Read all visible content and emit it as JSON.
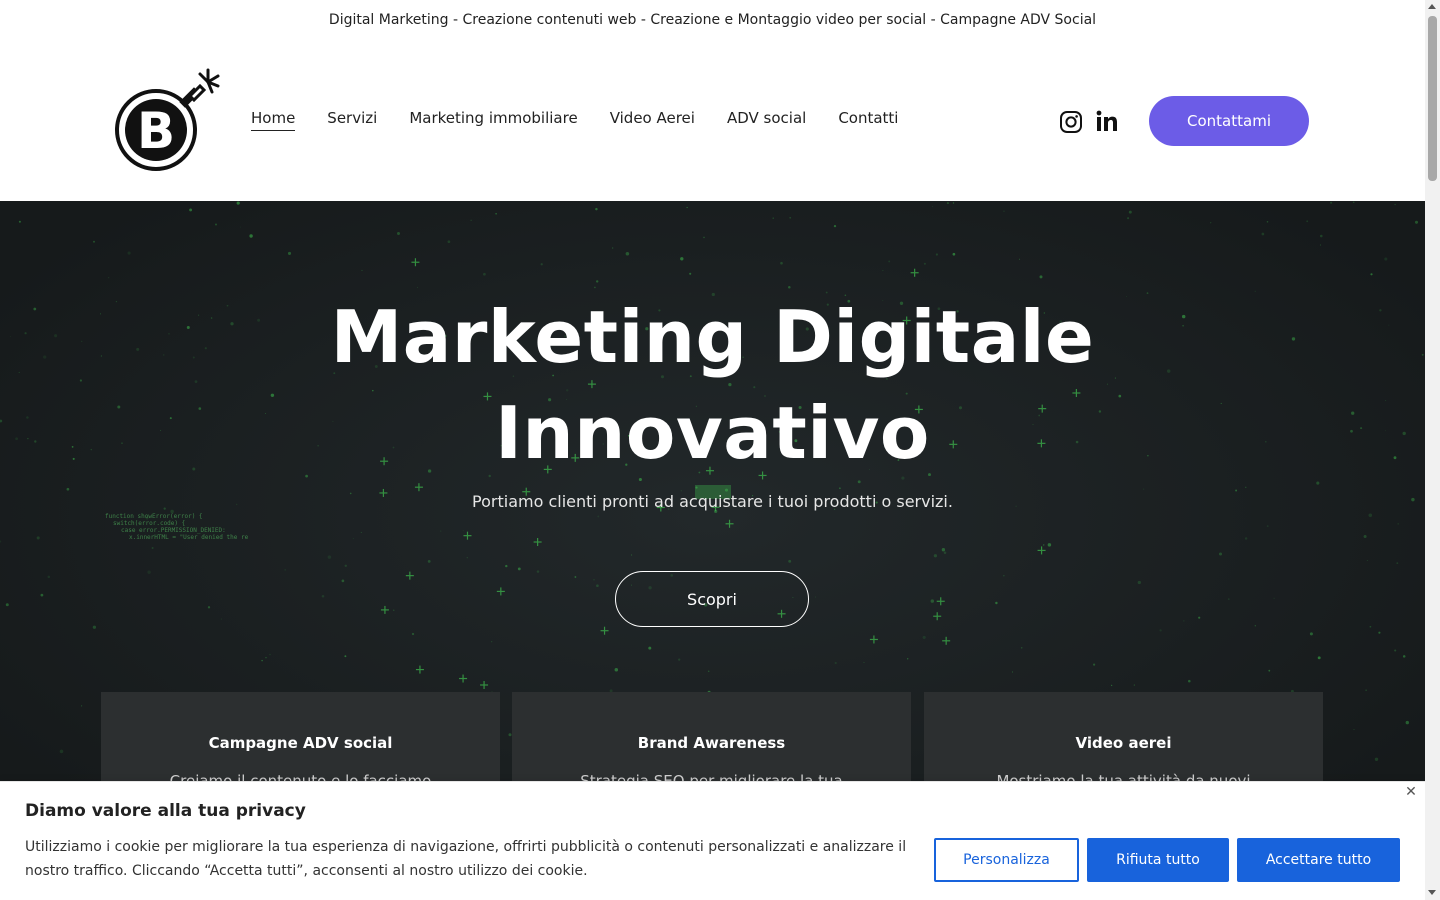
{
  "topbar": {
    "text": "Digital Marketing - Creazione contenuti web - Creazione e Montaggio video per social - Campagne ADV Social"
  },
  "header": {
    "logo_icon": "bomb-logo-icon",
    "nav": [
      {
        "label": "Home",
        "active": true
      },
      {
        "label": "Servizi",
        "active": false
      },
      {
        "label": "Marketing immobiliare",
        "active": false
      },
      {
        "label": "Video Aerei",
        "active": false
      },
      {
        "label": "ADV social",
        "active": false
      },
      {
        "label": "Contatti",
        "active": false
      }
    ],
    "social_icons": [
      "instagram-icon",
      "linkedin-icon"
    ],
    "cta_label": "Contattami",
    "cta_color": "#6c5ce7"
  },
  "hero": {
    "title_line1": "Marketing Digitale",
    "title_line2": "Innovativo",
    "subtitle": "Portiamo clienti pronti ad acquistare i tuoi prodotti o servizi.",
    "button_label": "Scopri",
    "background_color": "#1b1e1f",
    "accent_color": "#3fbf4f"
  },
  "cards": [
    {
      "title": "Campagne ADV social",
      "text": "Creiamo il contenuto e lo facciamo"
    },
    {
      "title": "Brand Awareness",
      "text": "Strategia SEO per migliorare la tua"
    },
    {
      "title": "Video aerei",
      "text": "Mostriamo la tua attività da nuovi"
    }
  ],
  "cookie": {
    "title": "Diamo valore alla tua privacy",
    "message": "Utilizziamo i cookie per migliorare la tua esperienza di navigazione, offrirti pubblicità o contenuti personalizzati e analizzare il nostro traffico. Cliccando “Accetta tutti”, acconsenti al nostro utilizzo dei cookie.",
    "close_icon": "close-icon",
    "buttons": {
      "customize": "Personalizza",
      "reject": "Rifiuta tutto",
      "accept": "Accettare tutto"
    },
    "button_color": "#1863dc"
  }
}
